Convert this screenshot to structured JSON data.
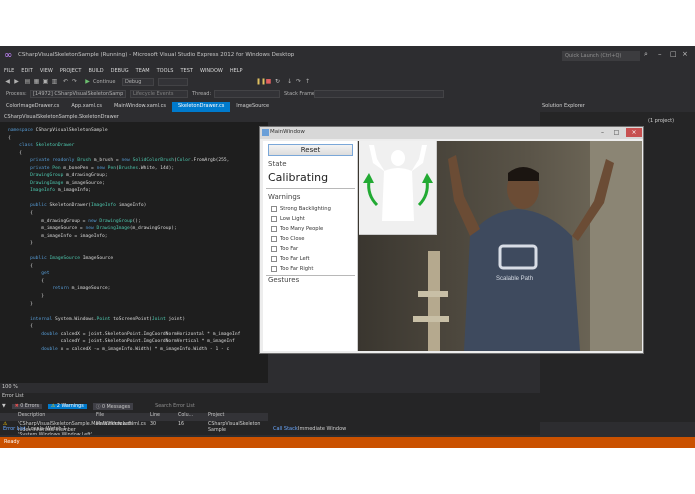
{
  "window": {
    "title": "CSharpVisualSkeletonSample (Running) - Microsoft Visual Studio Express 2012 for Windows Desktop",
    "quick_launch_placeholder": "Quick Launch (Ctrl+Q)"
  },
  "menu": [
    "FILE",
    "EDIT",
    "VIEW",
    "PROJECT",
    "BUILD",
    "DEBUG",
    "TEAM",
    "TOOLS",
    "TEST",
    "WINDOW",
    "HELP"
  ],
  "toolbar": {
    "continue_label": "Continue",
    "config": "Debug",
    "process_label": "Process:",
    "process_value": "[14972] CSharpVisualSkeletonSamp",
    "lifecycle": "Lifecycle Events",
    "thread_label": "Thread:",
    "stack_frame_label": "Stack Frame:"
  },
  "tabs": [
    {
      "label": "ColorImageDrawer.cs",
      "active": false
    },
    {
      "label": "App.xaml.cs",
      "active": false
    },
    {
      "label": "MainWindow.xaml.cs",
      "active": false
    },
    {
      "label": "SkeletonDrawer.cs",
      "active": true
    },
    {
      "label": "ImageSource",
      "active": false
    }
  ],
  "solution_explorer": {
    "title": "Solution Explorer",
    "item": "(1 project)"
  },
  "editor": {
    "nav": "CSharpVisualSkeletonSample.SkeletonDrawer",
    "zoom": "100 %"
  },
  "error_list": {
    "title": "Error List",
    "errors": "0 Errors",
    "warnings": "2 Warnings",
    "messages": "0 Messages",
    "search_placeholder": "Search Error List",
    "columns": [
      "Description",
      "File",
      "Line",
      "Colu...",
      "Project"
    ],
    "rows": [
      {
        "description": "'CSharpVisualSkeletonSample.MainWindow.Left' hides inherited member 'System.Windows.Window.Left'. Use the new keyword if hiding was intended.",
        "file": "MainWindow.xaml.cs",
        "line": "30",
        "col": "16",
        "project": "CSharpVisualSkeleton Sample"
      },
      {
        "description": "'CSharpVisualSkeletonSample.M",
        "file": "MainWindow.xaml",
        "line": "",
        "col": "",
        "project": "CSharpVisualSkeleton"
      }
    ]
  },
  "bottom_tabs": [
    "Error List",
    "Locals",
    "Watch 1"
  ],
  "bottom_tabs_right": [
    "Call Stack",
    "Immediate Window"
  ],
  "status": "Ready",
  "main_window": {
    "title": "MainWindow",
    "reset_label": "Reset",
    "state_label": "State",
    "state_value": "Calibrating",
    "warnings_label": "Warnings",
    "warnings": [
      "Strong Backlighting",
      "Low Light",
      "Too Many People",
      "Too Close",
      "Too Far",
      "Too Far Left",
      "Too Far Right"
    ],
    "gestures_label": "Gestures"
  },
  "camera": {
    "shirt_text": "Scalable Path"
  },
  "colors": {
    "accent": "#007acc",
    "status_bar": "#ca5100",
    "ide_bg": "#2d2d30",
    "editor_bg": "#1e1e1e",
    "warning": "#ffcc00",
    "gesture_arrow": "#22aa33"
  }
}
